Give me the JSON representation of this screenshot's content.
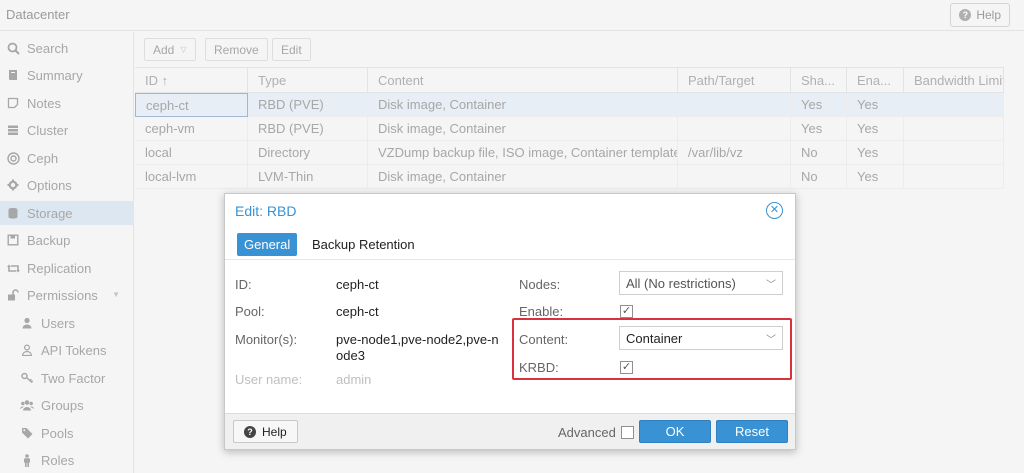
{
  "window": {
    "title": "Datacenter",
    "help_label": "Help"
  },
  "sidebar": {
    "items": [
      {
        "label": "Search",
        "icon": "search-icon"
      },
      {
        "label": "Summary",
        "icon": "book-icon"
      },
      {
        "label": "Notes",
        "icon": "notes-icon"
      },
      {
        "label": "Cluster",
        "icon": "server-icon"
      },
      {
        "label": "Ceph",
        "icon": "ceph-icon"
      },
      {
        "label": "Options",
        "icon": "gear-icon"
      },
      {
        "label": "Storage",
        "icon": "database-icon"
      },
      {
        "label": "Backup",
        "icon": "floppy-icon"
      },
      {
        "label": "Replication",
        "icon": "retweet-icon"
      },
      {
        "label": "Permissions",
        "icon": "unlock-icon"
      },
      {
        "label": "Users",
        "icon": "user-icon"
      },
      {
        "label": "API Tokens",
        "icon": "user-outline-icon"
      },
      {
        "label": "Two Factor",
        "icon": "key-icon"
      },
      {
        "label": "Groups",
        "icon": "users-icon"
      },
      {
        "label": "Pools",
        "icon": "tags-icon"
      },
      {
        "label": "Roles",
        "icon": "male-icon"
      }
    ]
  },
  "toolbar": {
    "add_label": "Add",
    "remove_label": "Remove",
    "edit_label": "Edit"
  },
  "storage_grid": {
    "columns": [
      "ID ↑",
      "Type",
      "Content",
      "Path/Target",
      "Sha...",
      "Ena...",
      "Bandwidth Limit"
    ],
    "rows": [
      [
        "ceph-ct",
        "RBD (PVE)",
        "Disk image, Container",
        "",
        "Yes",
        "Yes",
        ""
      ],
      [
        "ceph-vm",
        "RBD (PVE)",
        "Disk image, Container",
        "",
        "Yes",
        "Yes",
        ""
      ],
      [
        "local",
        "Directory",
        "VZDump backup file, ISO image, Container template",
        "/var/lib/vz",
        "No",
        "Yes",
        ""
      ],
      [
        "local-lvm",
        "LVM-Thin",
        "Disk image, Container",
        "",
        "No",
        "Yes",
        ""
      ]
    ]
  },
  "dialog": {
    "title": "Edit: RBD",
    "tabs": [
      "General",
      "Backup Retention"
    ],
    "fields": {
      "id_label": "ID:",
      "id_value": "ceph-ct",
      "pool_label": "Pool:",
      "pool_value": "ceph-ct",
      "monitors_label": "Monitor(s):",
      "monitors_value": "pve-node1,pve-node2,pve-node3",
      "username_label": "User name:",
      "username_value": "admin",
      "nodes_label": "Nodes:",
      "nodes_value": "All (No restrictions)",
      "enable_label": "Enable:",
      "enable_checked": true,
      "content_label": "Content:",
      "content_value": "Container",
      "krbd_label": "KRBD:",
      "krbd_checked": true
    },
    "footer": {
      "help_label": "Help",
      "advanced_label": "Advanced",
      "advanced_checked": false,
      "ok_label": "OK",
      "reset_label": "Reset"
    }
  },
  "colors": {
    "accent": "#3892d4",
    "highlight_box": "#d7323e",
    "selected_row": "#e7eef5"
  }
}
